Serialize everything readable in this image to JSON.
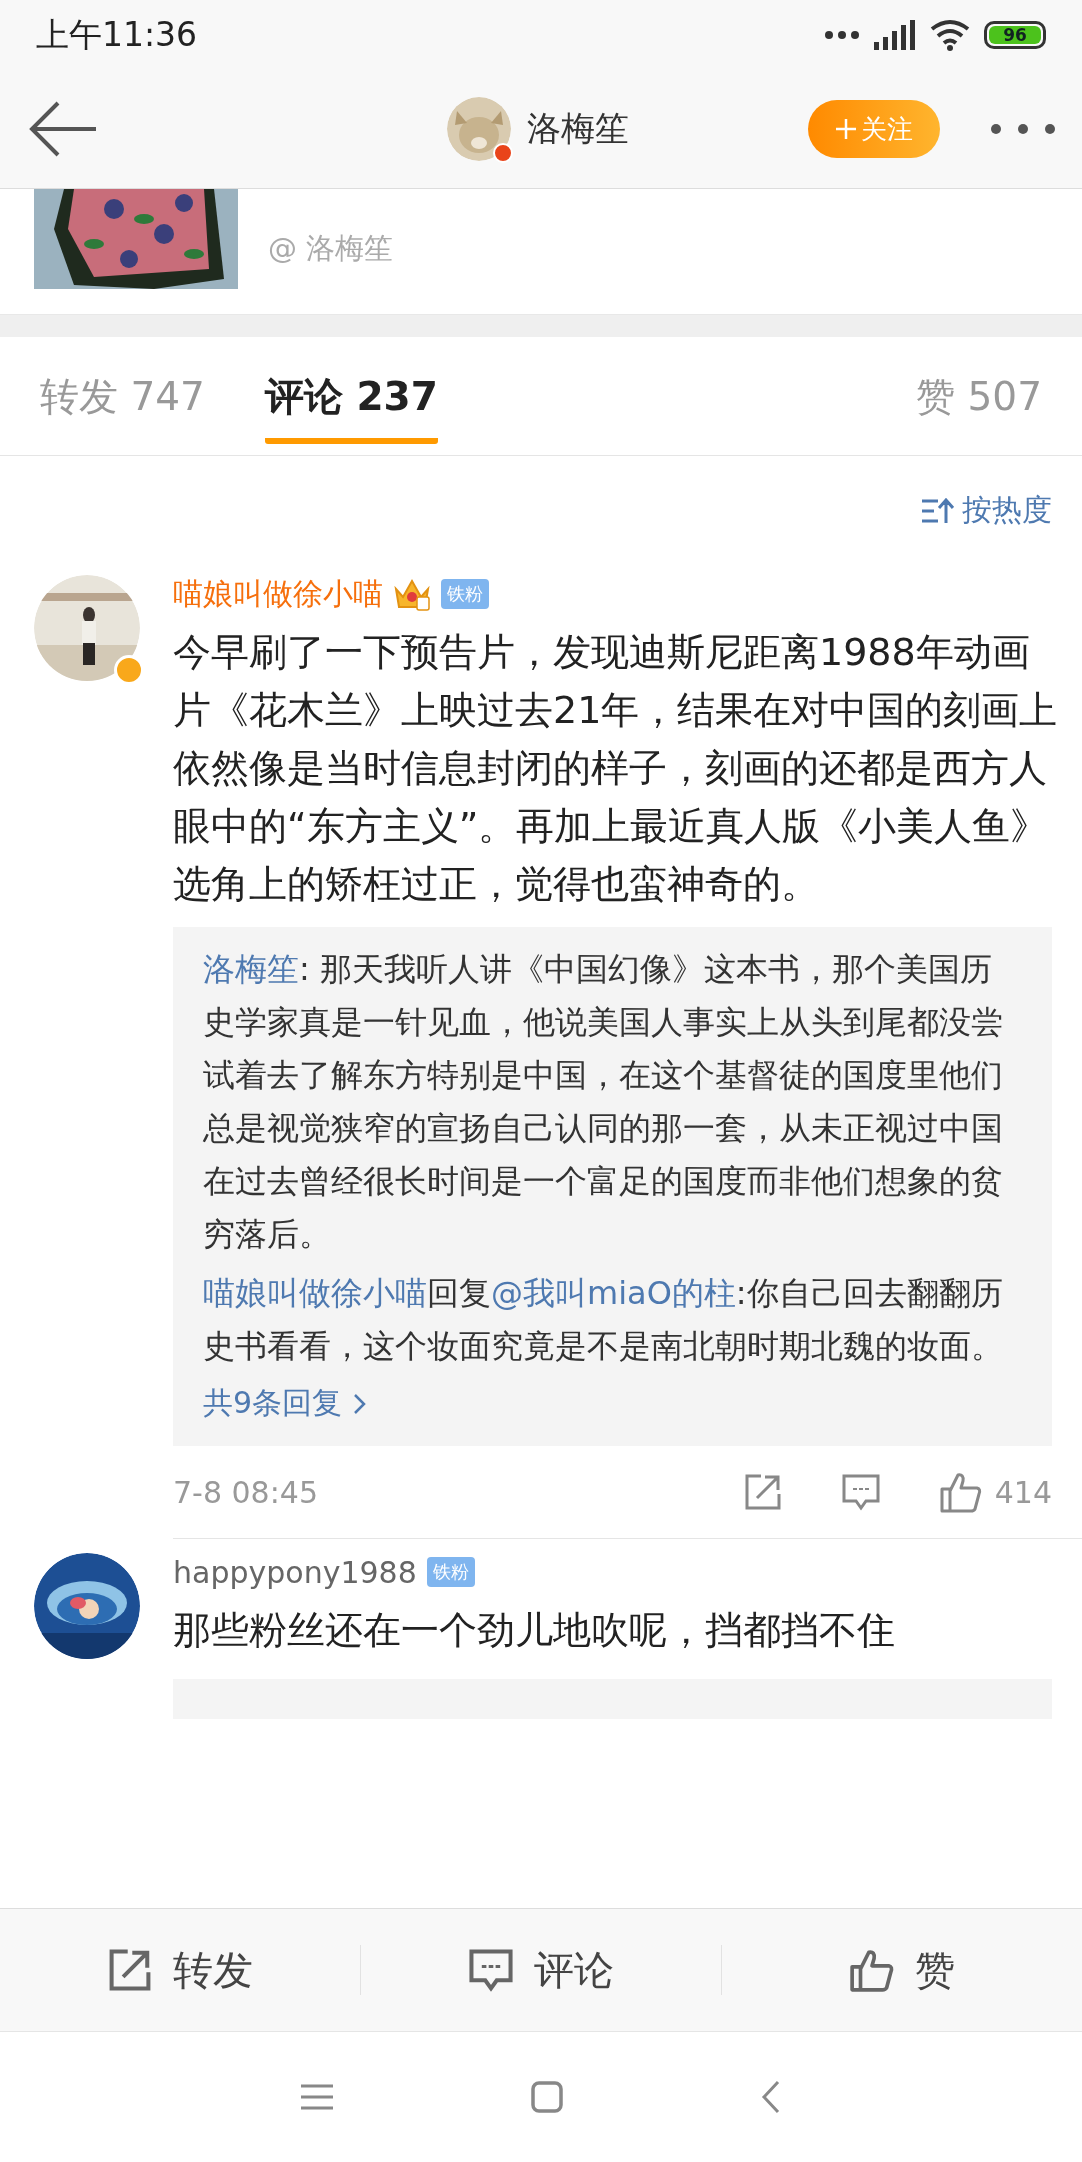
{
  "status_bar": {
    "time": "上午11:36",
    "battery": "96"
  },
  "header": {
    "title": "洛梅笙",
    "verified": true,
    "follow_label": "关注"
  },
  "quoted_post": {
    "kind": "picture",
    "author": "@ 洛梅笙"
  },
  "tabs": [
    {
      "label": "转发 747",
      "selected": false
    },
    {
      "label": "评论 237",
      "selected": true
    },
    {
      "label": "赞 507",
      "selected": false
    }
  ],
  "sort": "按热度",
  "comments": [
    {
      "name": "喵娘叫做徐小喵",
      "vip": true,
      "verified": true,
      "badge": "铁粉",
      "text": "今早刷了一下预告片，发现迪斯尼距离1988年动画片《花木兰》上映过去21年，结果在对中国的刻画上依然像是当时信息封闭的样子，刻画的还都是西方人眼中的“东方主义”。再加上最近真人版《小美人鱼》选角上的矫枉过正，觉得也蛮神奇的。",
      "replies": [
        {
          "author": "洛梅笙",
          "text": ": 那天我听人讲《中国幻像》这本书，那个美国历史学家真是一针见血，他说美国人事实上从头到尾都没尝试着去了解东方特别是中国，在这个基督徒的国度里他们总是视觉狭窄的宣扬自己认同的那一套，从未正视过中国在过去曾经很长时间是一个富足的国度而非他们想象的贫穷落后。"
        },
        {
          "author": "喵娘叫做徐小喵",
          "connector": "回复",
          "target": "@我叫miaO的柱",
          "text": ":你自己回去翻翻历史书看看，这个妆面究竟是不是南北朝时期北魏的妆面。"
        }
      ],
      "more_replies": "共9条回复",
      "time": "7-8 08:45",
      "likes": "414"
    },
    {
      "name": "happypony1988",
      "vip": false,
      "verified": false,
      "badge": "铁粉",
      "text": "那些粉丝还在一个劲儿地吹呢，挡都挡不住"
    }
  ],
  "bottom_bar": [
    {
      "kind": "share",
      "label": "转发"
    },
    {
      "kind": "comment",
      "label": "评论"
    },
    {
      "kind": "like",
      "label": "赞"
    }
  ]
}
